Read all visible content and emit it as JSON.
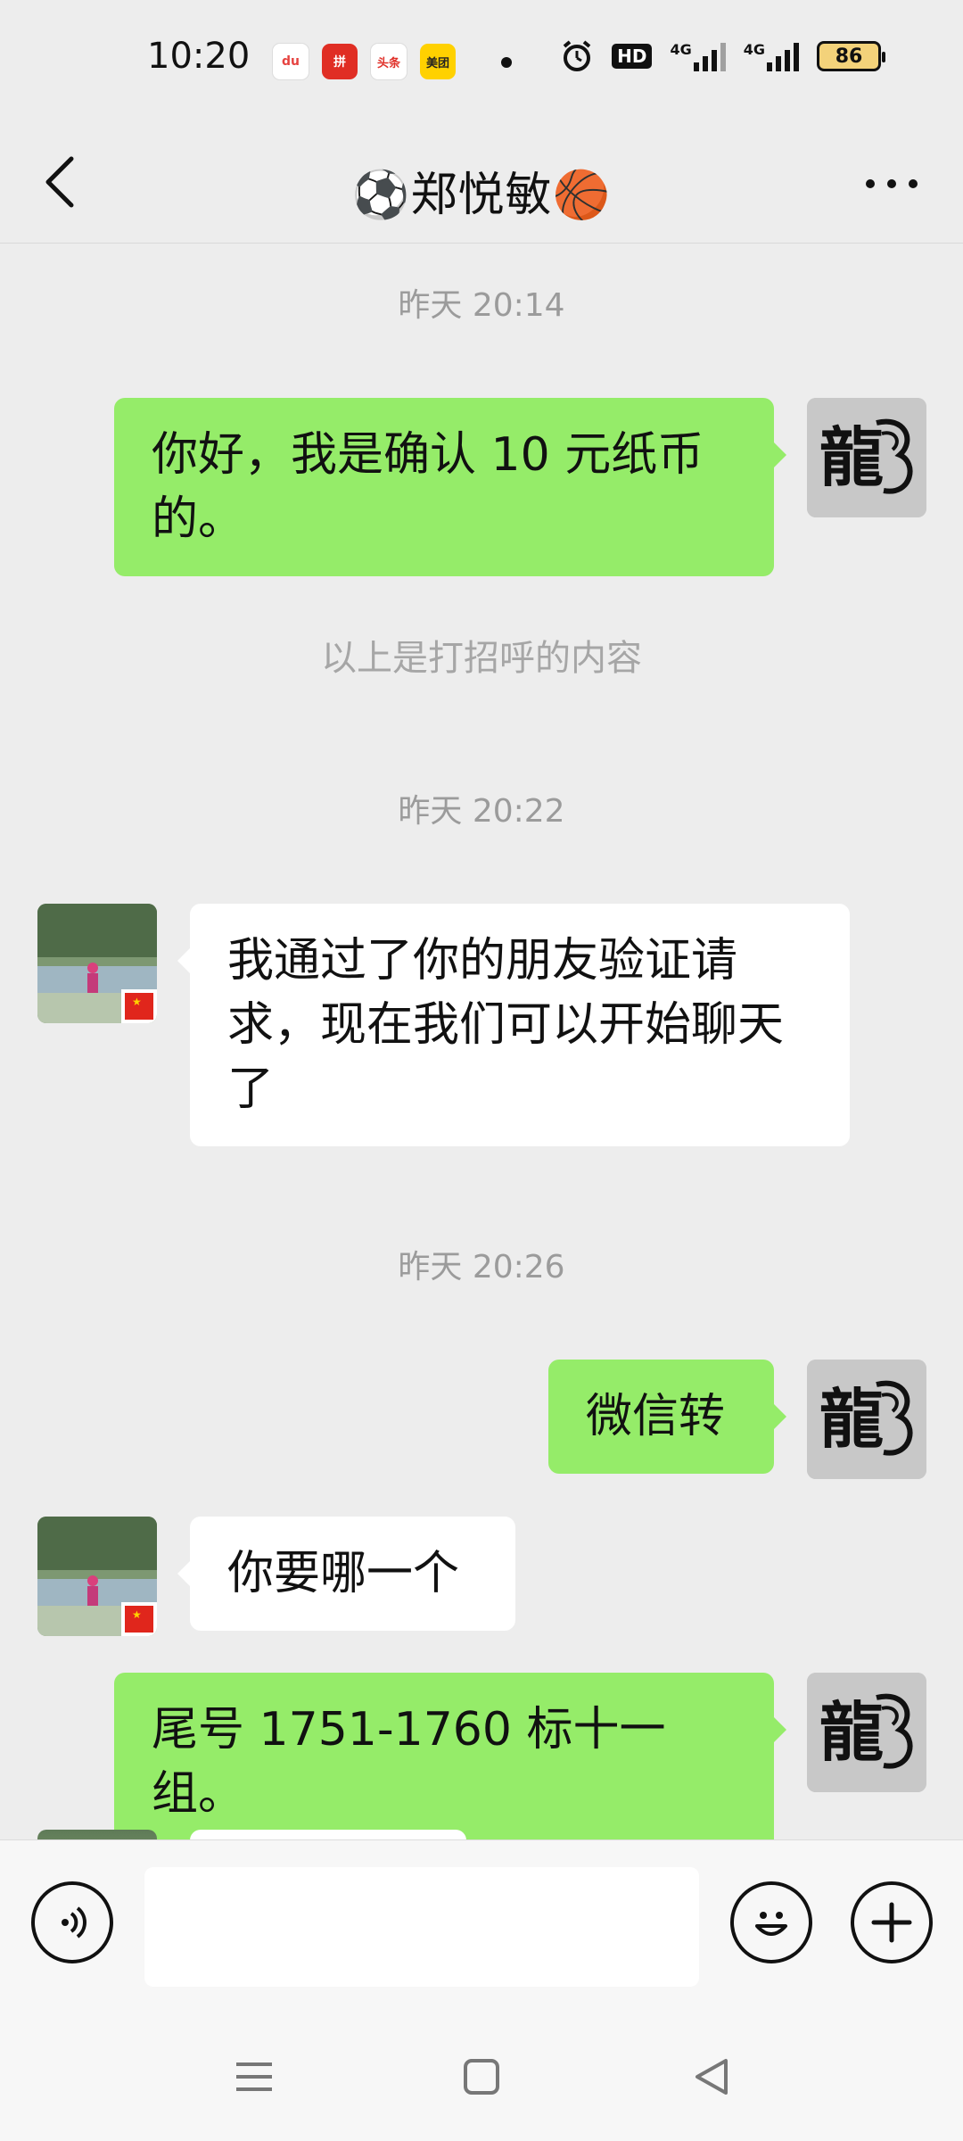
{
  "status_bar": {
    "time": "10:20",
    "apps": [
      {
        "name": "map-app-icon",
        "label": "du",
        "color": "#ffffff",
        "fg": "#e64340"
      },
      {
        "name": "pinduoduo-app-icon",
        "label": "拼",
        "color": "#e02e24",
        "fg": "#ffffff"
      },
      {
        "name": "toutiao-app-icon",
        "label": "头条",
        "color": "#ffffff",
        "fg": "#e0312a"
      },
      {
        "name": "meituan-app-icon",
        "label": "美团",
        "color": "#ffd100",
        "fg": "#222222"
      }
    ],
    "hd_label": "HD",
    "net1": "4G",
    "net2": "4G",
    "battery": "86"
  },
  "header": {
    "title": "⚽郑悦敏🏀"
  },
  "messages": {
    "ts1": "昨天 20:14",
    "m1": "你好，我是确认 10 元纸币的。",
    "sys1": "以上是打招呼的内容",
    "ts2": "昨天 20:22",
    "m2": "我通过了你的朋友验证请求，现在我们可以开始聊天了",
    "ts3": "昨天 20:26",
    "m3": "微信转",
    "m4": "你要哪一个",
    "m5": "尾号 1751-1760 标十一组。"
  },
  "avatars": {
    "self_glyph": "龍"
  },
  "colors": {
    "self_bubble": "#95ec69",
    "other_bubble": "#ffffff",
    "background": "#ededed"
  }
}
